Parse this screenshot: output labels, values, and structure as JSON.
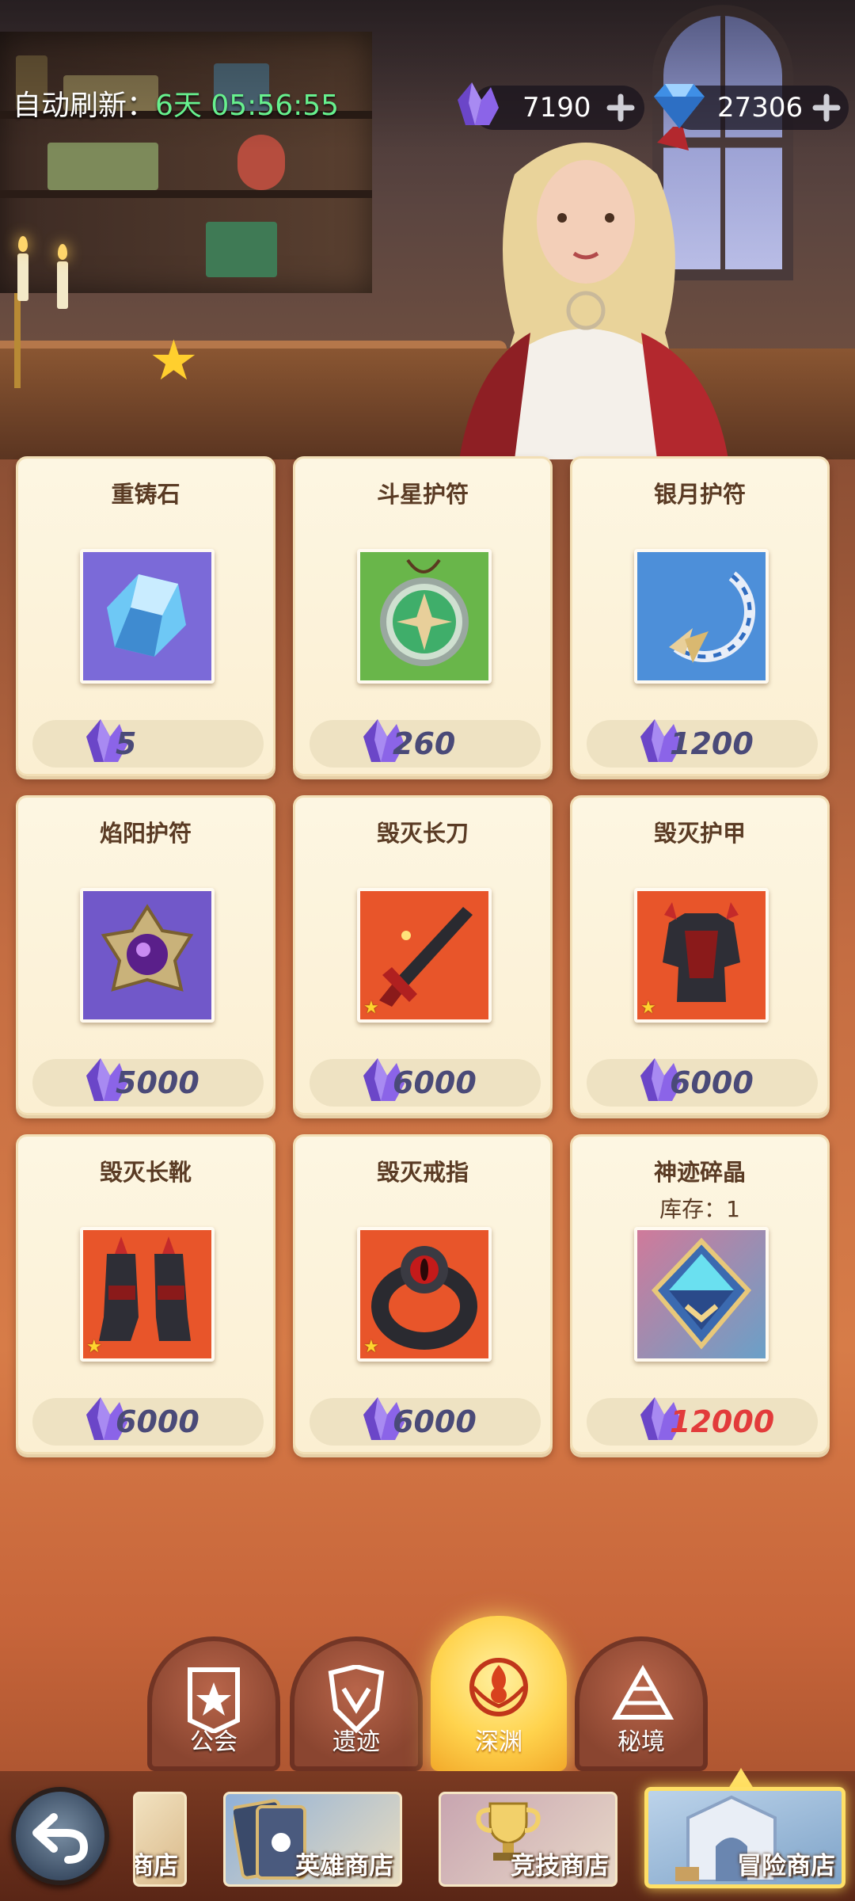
{
  "header": {
    "refresh_label": "自动刷新：",
    "refresh_time": "6天 05:56:55",
    "currencies": [
      {
        "name": "purple-crystal-icon",
        "value": "7190"
      },
      {
        "name": "blue-diamond-icon",
        "value": "27306"
      }
    ]
  },
  "shop_items": [
    {
      "name": "重铸石",
      "price": "5",
      "icon": "reforge-stone-icon",
      "bg": "#7b6ad8"
    },
    {
      "name": "斗星护符",
      "price": "260",
      "icon": "star-amulet-icon",
      "bg": "#69b64a"
    },
    {
      "name": "银月护符",
      "price": "1200",
      "icon": "silver-moon-amulet-icon",
      "bg": "#4d8fd9"
    },
    {
      "name": "焰阳护符",
      "price": "5000",
      "icon": "flame-sun-amulet-icon",
      "bg": "#7158c9"
    },
    {
      "name": "毁灭长刀",
      "price": "6000",
      "icon": "destruction-blade-icon",
      "bg": "#e8552a"
    },
    {
      "name": "毁灭护甲",
      "price": "6000",
      "icon": "destruction-armor-icon",
      "bg": "#e8552a"
    },
    {
      "name": "毁灭长靴",
      "price": "6000",
      "icon": "destruction-boots-icon",
      "bg": "#e8552a"
    },
    {
      "name": "毁灭戒指",
      "price": "6000",
      "icon": "destruction-ring-icon",
      "bg": "#e8552a"
    },
    {
      "name": "神迹碎晶",
      "stock": "库存：1",
      "price": "12000",
      "price_color": "#e23b3b",
      "icon": "miracle-shard-icon",
      "bg": "#b9a0c8"
    }
  ],
  "category_tabs": [
    {
      "label": "公会",
      "icon": "guild-banner-icon",
      "active": false
    },
    {
      "label": "遗迹",
      "icon": "relic-shield-icon",
      "active": false
    },
    {
      "label": "深渊",
      "icon": "abyss-flame-icon",
      "active": true
    },
    {
      "label": "秘境",
      "icon": "secret-realm-icon",
      "active": false
    }
  ],
  "shop_tabs": [
    {
      "label": "商店",
      "active": false
    },
    {
      "label": "英雄商店",
      "active": false
    },
    {
      "label": "竞技商店",
      "active": false
    },
    {
      "label": "冒险商店",
      "active": true
    }
  ]
}
